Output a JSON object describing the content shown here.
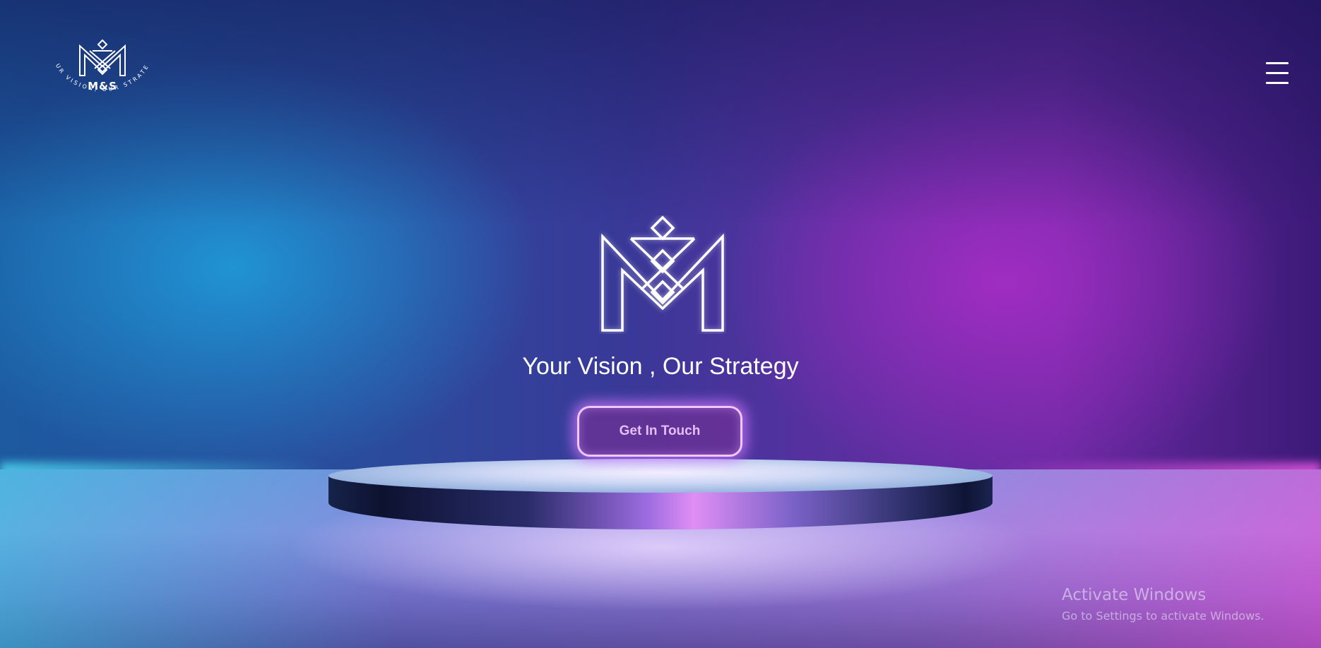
{
  "brand": {
    "name": "M&S",
    "slogan_arc": "YOUR VISION, OUR STRATEGY",
    "logo_icon": "ms-monogram-icon"
  },
  "header": {
    "menu_icon": "hamburger-menu-icon"
  },
  "hero": {
    "tagline": "Your Vision , Our Strategy",
    "cta_label": "Get In Touch"
  },
  "watermark": {
    "title": "Activate Windows",
    "subtitle": "Go to Settings to activate Windows."
  },
  "colors": {
    "accent_glow": "#d278ff",
    "button_border": "#f0c8ff",
    "button_text": "#e6bdf7",
    "background_blue": "#1eaae6",
    "background_purple": "#aa2dc8"
  }
}
